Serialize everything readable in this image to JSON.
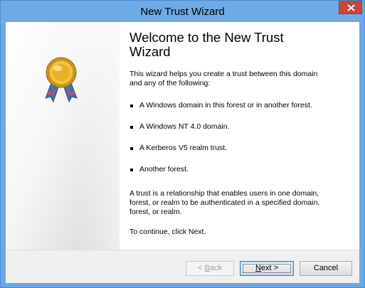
{
  "window": {
    "title": "New Trust Wizard",
    "close_icon": "close-icon"
  },
  "left_panel": {
    "icon": "award-ribbon-icon"
  },
  "content": {
    "heading_line1": "Welcome to the New Trust",
    "heading_line2": "Wizard",
    "intro_line1": "This wizard helps you create a trust between this domain",
    "intro_line2": "and any of the following:",
    "bullets": [
      "A Windows domain in this forest or in another forest.",
      "A Windows NT 4.0 domain.",
      "A Kerberos V5 realm trust.",
      "Another forest."
    ],
    "para_line1": "A trust is a relationship that enables users in one domain,",
    "para_line2": "forest, or realm to be authenticated in a specified domain,",
    "para_line3": "forest, or realm.",
    "continue": "To continue, click Next."
  },
  "buttons": {
    "back_prefix": "< ",
    "back_mnemonic": "B",
    "back_rest": "ack",
    "next_mnemonic": "N",
    "next_rest": "ext >",
    "cancel": "Cancel"
  },
  "colors": {
    "titlebar": "#6eaae6",
    "close_button": "#c7463a",
    "footer": "#f0f0f0"
  }
}
